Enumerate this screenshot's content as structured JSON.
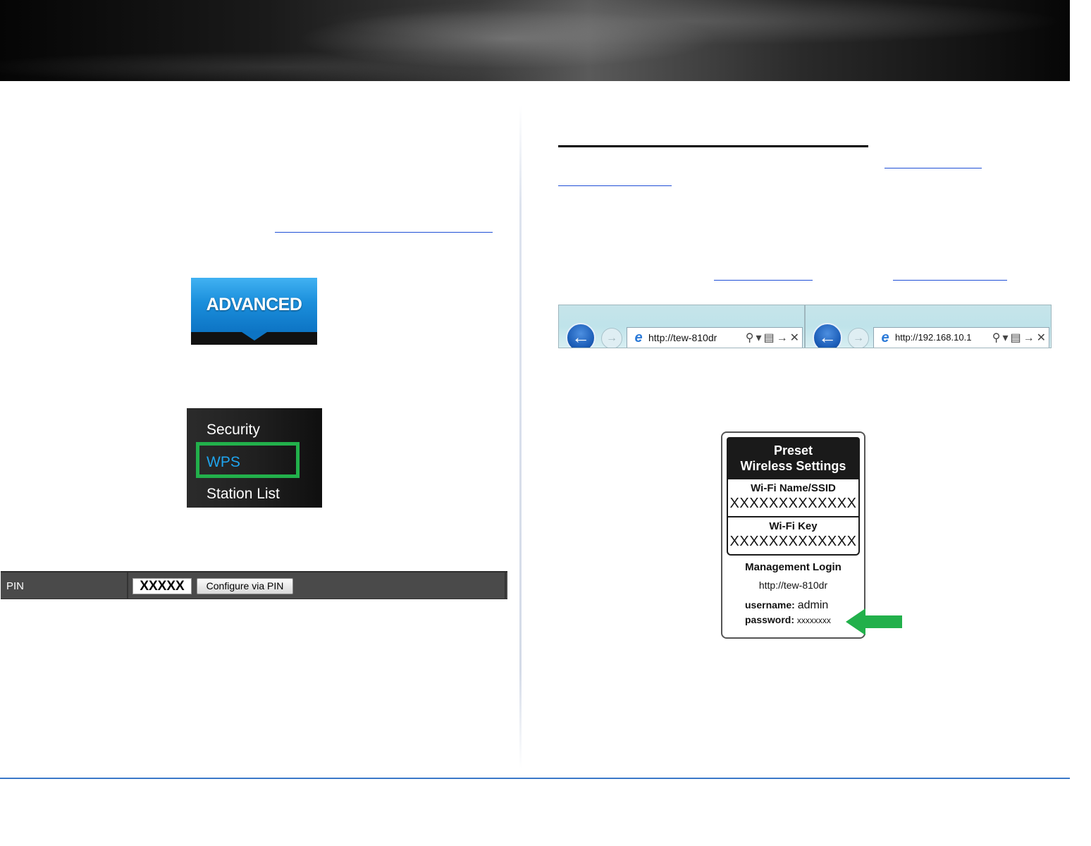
{
  "advanced_button": {
    "label": "ADVANCED"
  },
  "wireless_menu": {
    "items": [
      {
        "label": "Security",
        "selected": false
      },
      {
        "label": "WPS",
        "selected": true
      },
      {
        "label": "Station List",
        "selected": false
      }
    ],
    "highlight_color": "#22b04b",
    "selected_text_color": "#1fa4ee"
  },
  "pin_row": {
    "label": "PIN",
    "value": "XXXXX",
    "button_label": "Configure via PIN"
  },
  "browsers": [
    {
      "address": "http://tew-810dr"
    },
    {
      "address": "http://192.168.10.1"
    }
  ],
  "label_card": {
    "heading_line1": "Preset",
    "heading_line2": "Wireless Settings",
    "ssid_title": "Wi-Fi Name/SSID",
    "ssid_value": "XXXXXXXXXXXXX",
    "key_title": "Wi-Fi Key",
    "key_value": "XXXXXXXXXXXXX",
    "management_title": "Management Login",
    "management_url": "http://tew-810dr",
    "username_label": "username:",
    "username_value": "admin",
    "password_label": "password:",
    "password_value": "xxxxxxxx"
  },
  "icons": {
    "back": "back-arrow-icon",
    "forward": "forward-arrow-icon",
    "browser": "internet-explorer-icon",
    "search": "search-icon",
    "dropdown": "dropdown-icon",
    "compat": "compatibility-view-icon",
    "go": "go-arrow-icon",
    "stop": "stop-icon",
    "pointer": "green-arrow-icon"
  },
  "colors": {
    "accent_blue": "#1b8fdc",
    "link_blue": "#1f4fd6",
    "highlight_green": "#22b04b",
    "footer_line": "#3a78c9"
  }
}
